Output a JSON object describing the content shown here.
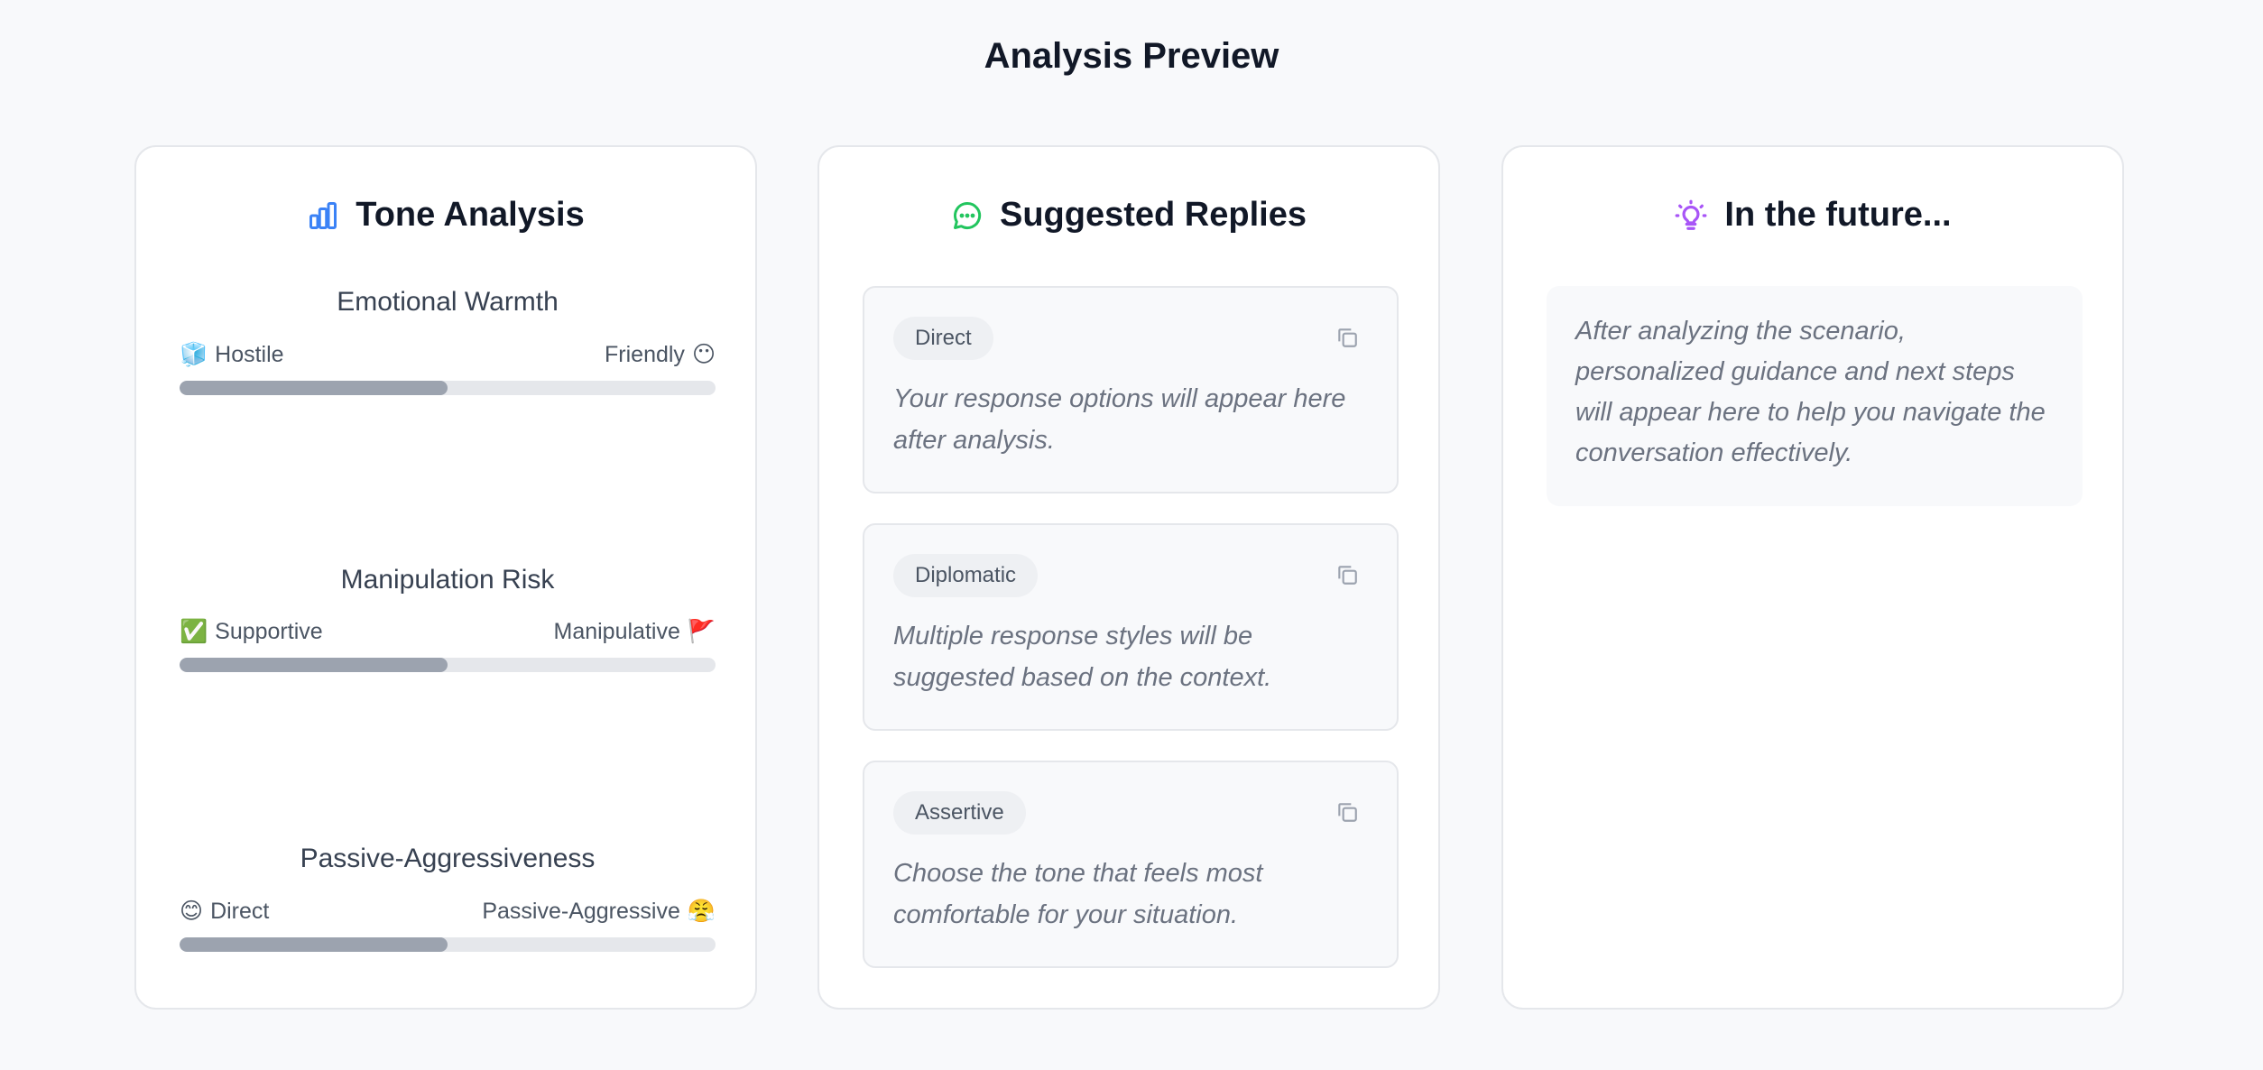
{
  "page": {
    "title": "Analysis Preview"
  },
  "tone": {
    "title": "Tone Analysis",
    "icon": "bar-chart-icon",
    "metrics": [
      {
        "title": "Emotional Warmth",
        "left_emoji": "🧊",
        "left_label": "Hostile",
        "right_label": "Friendly",
        "right_emoji": "😶",
        "value": 0.5
      },
      {
        "title": "Manipulation Risk",
        "left_emoji": "✅",
        "left_label": "Supportive",
        "right_label": "Manipulative",
        "right_emoji": "🚩",
        "value": 0.5
      },
      {
        "title": "Passive-Aggressiveness",
        "left_emoji": "😊",
        "left_label": "Direct",
        "right_label": "Passive-Aggressive",
        "right_emoji": "😤",
        "value": 0.5
      }
    ]
  },
  "replies": {
    "title": "Suggested Replies",
    "icon": "chat-bubble-icon",
    "items": [
      {
        "tag": "Direct",
        "text": "Your response options will appear here after analysis."
      },
      {
        "tag": "Diplomatic",
        "text": "Multiple response styles will be suggested based on the context."
      },
      {
        "tag": "Assertive",
        "text": "Choose the tone that feels most comfortable for your situation."
      }
    ]
  },
  "future": {
    "title": "In the future...",
    "icon": "lightbulb-icon",
    "text": "After analyzing the scenario, personalized guidance and next steps will appear here to help you navigate the conversation effectively."
  },
  "colors": {
    "tone_icon": "#3b82f6",
    "replies_icon": "#22c55e",
    "future_icon": "#a855f7",
    "bar_fill": "#9ca3af",
    "bar_track": "#e5e7eb"
  }
}
